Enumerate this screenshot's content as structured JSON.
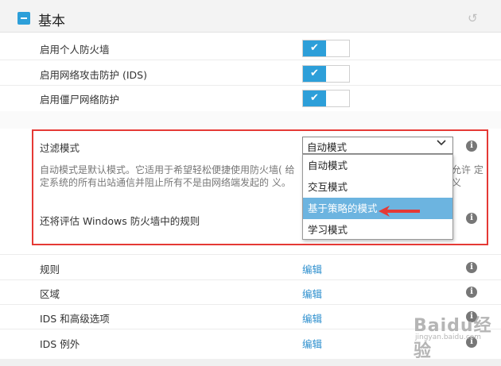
{
  "section": {
    "title": "基本"
  },
  "toggles": [
    {
      "label": "启用个人防火墙",
      "state": "on"
    },
    {
      "label": "启用网络攻击防护 (IDS)",
      "state": "on"
    },
    {
      "label": "启用僵尸网络防护",
      "state": "on"
    }
  ],
  "filter": {
    "label": "过滤模式",
    "selected": "自动模式",
    "description": "自动模式是默认模式。它适用于希望轻松便捷使用防火墙( 给定系统的所有出站通信并阻止所有不是由网络端发起的 义。",
    "description_right": "允许 定义",
    "options": [
      "自动模式",
      "交互模式",
      "基于策略的模式",
      "学习模式"
    ],
    "highlighted_option": "基于策略的模式"
  },
  "evaluate_label": "还将评估 Windows 防火墙中的规则",
  "settings_rows": [
    {
      "label": "规则",
      "action": "编辑"
    },
    {
      "label": "区域",
      "action": "编辑"
    },
    {
      "label": "IDS 和高级选项",
      "action": "编辑"
    },
    {
      "label": "IDS 例外",
      "action": "编辑"
    }
  ],
  "icons": {
    "check": "✔",
    "info": "i",
    "chevron": "⌄",
    "reset": "↺"
  },
  "watermark": {
    "text": "Baidu经验",
    "sub": "jingyan.baidu.com"
  },
  "colors": {
    "accent": "#2d9fd9",
    "highlight": "#6cb4e0",
    "annotation": "#e53935"
  }
}
